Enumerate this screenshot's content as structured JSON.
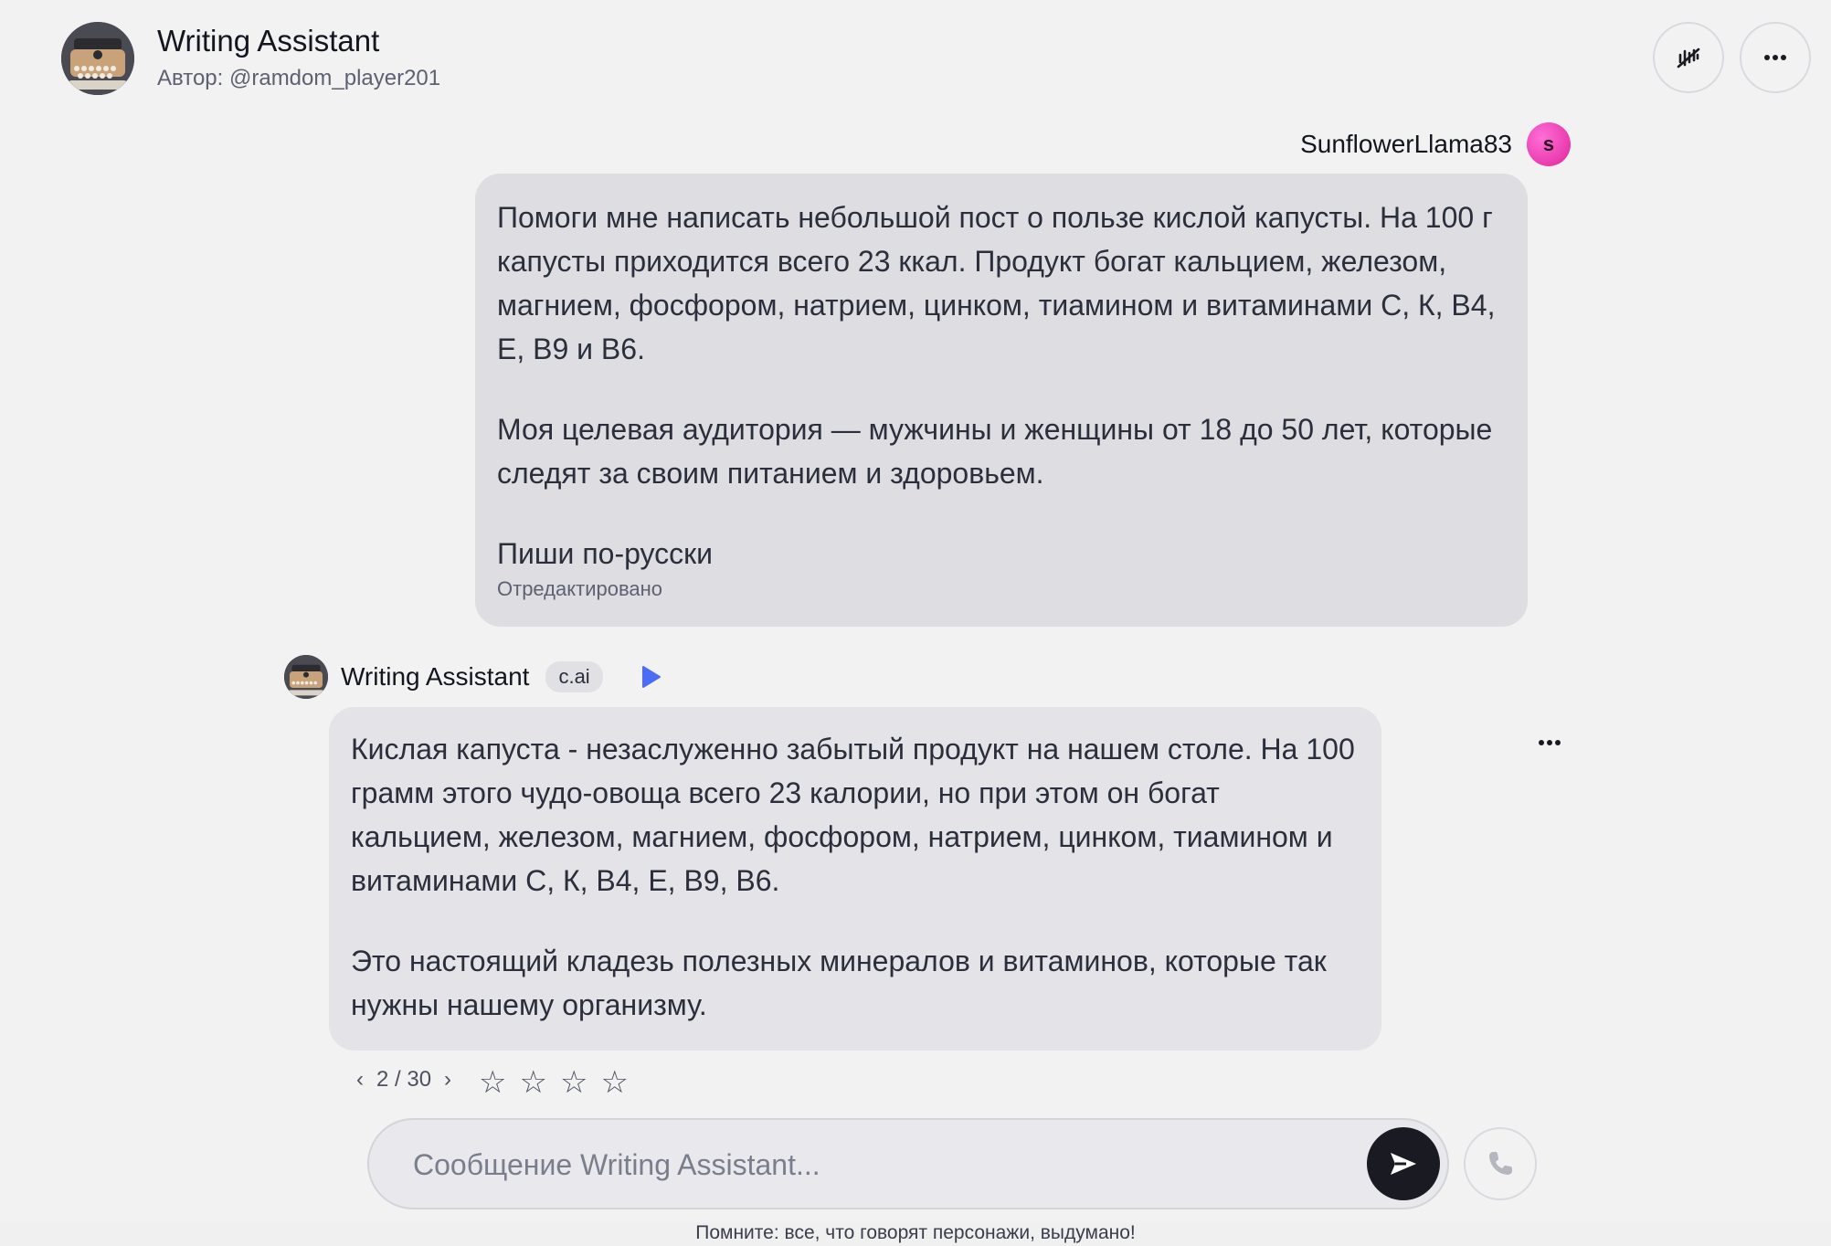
{
  "header": {
    "title": "Writing Assistant",
    "author": "Автор: @ramdom_player201",
    "avatar_icon": "typewriter-avatar-icon",
    "voice_button_icon": "voice-off-icon",
    "more_button_icon": "more-horizontal-icon"
  },
  "user": {
    "name": "SunflowerLlama83",
    "avatar_letter": "s",
    "avatar_color": "#f04fc6"
  },
  "user_message": {
    "paragraphs": [
      "Помоги мне написать небольшой пост о пользе кислой капусты. На 100 г капусты приходится всего 23 ккал. Продукт богат кальцием, железом, магнием, фосфором, натрием, цинком, тиамином и витаминами С, К, В4, Е, В9 и В6.",
      "Моя целевая аудитория — мужчины и женщины от 18 до 50 лет, которые следят за своим питанием и здоровьем.",
      "Пиши по-русски"
    ],
    "edited_label": "Отредактировано"
  },
  "bot": {
    "name": "Writing Assistant",
    "badge": "c.ai",
    "play_color": "#4a6cf7"
  },
  "bot_message": {
    "paragraphs": [
      "Кислая капуста - незаслуженно забытый продукт на нашем столе. На 100 грамм этого чудо-овоща всего 23 калории, но при этом он богат кальцием, железом, магнием, фосфором, натрием, цинком, тиамином и витаминами С, К, В4, Е, В9, В6.",
      "Это настоящий кладезь полезных минералов и витаминов, которые так нужны нашему организму."
    ]
  },
  "pager": {
    "prev": "‹",
    "position": "2 / 30",
    "next": "›",
    "rating_stars": 4
  },
  "composer": {
    "placeholder": "Сообщение Writing Assistant...",
    "value": ""
  },
  "disclaimer": "Помните: все, что говорят персонажи, выдумано!"
}
